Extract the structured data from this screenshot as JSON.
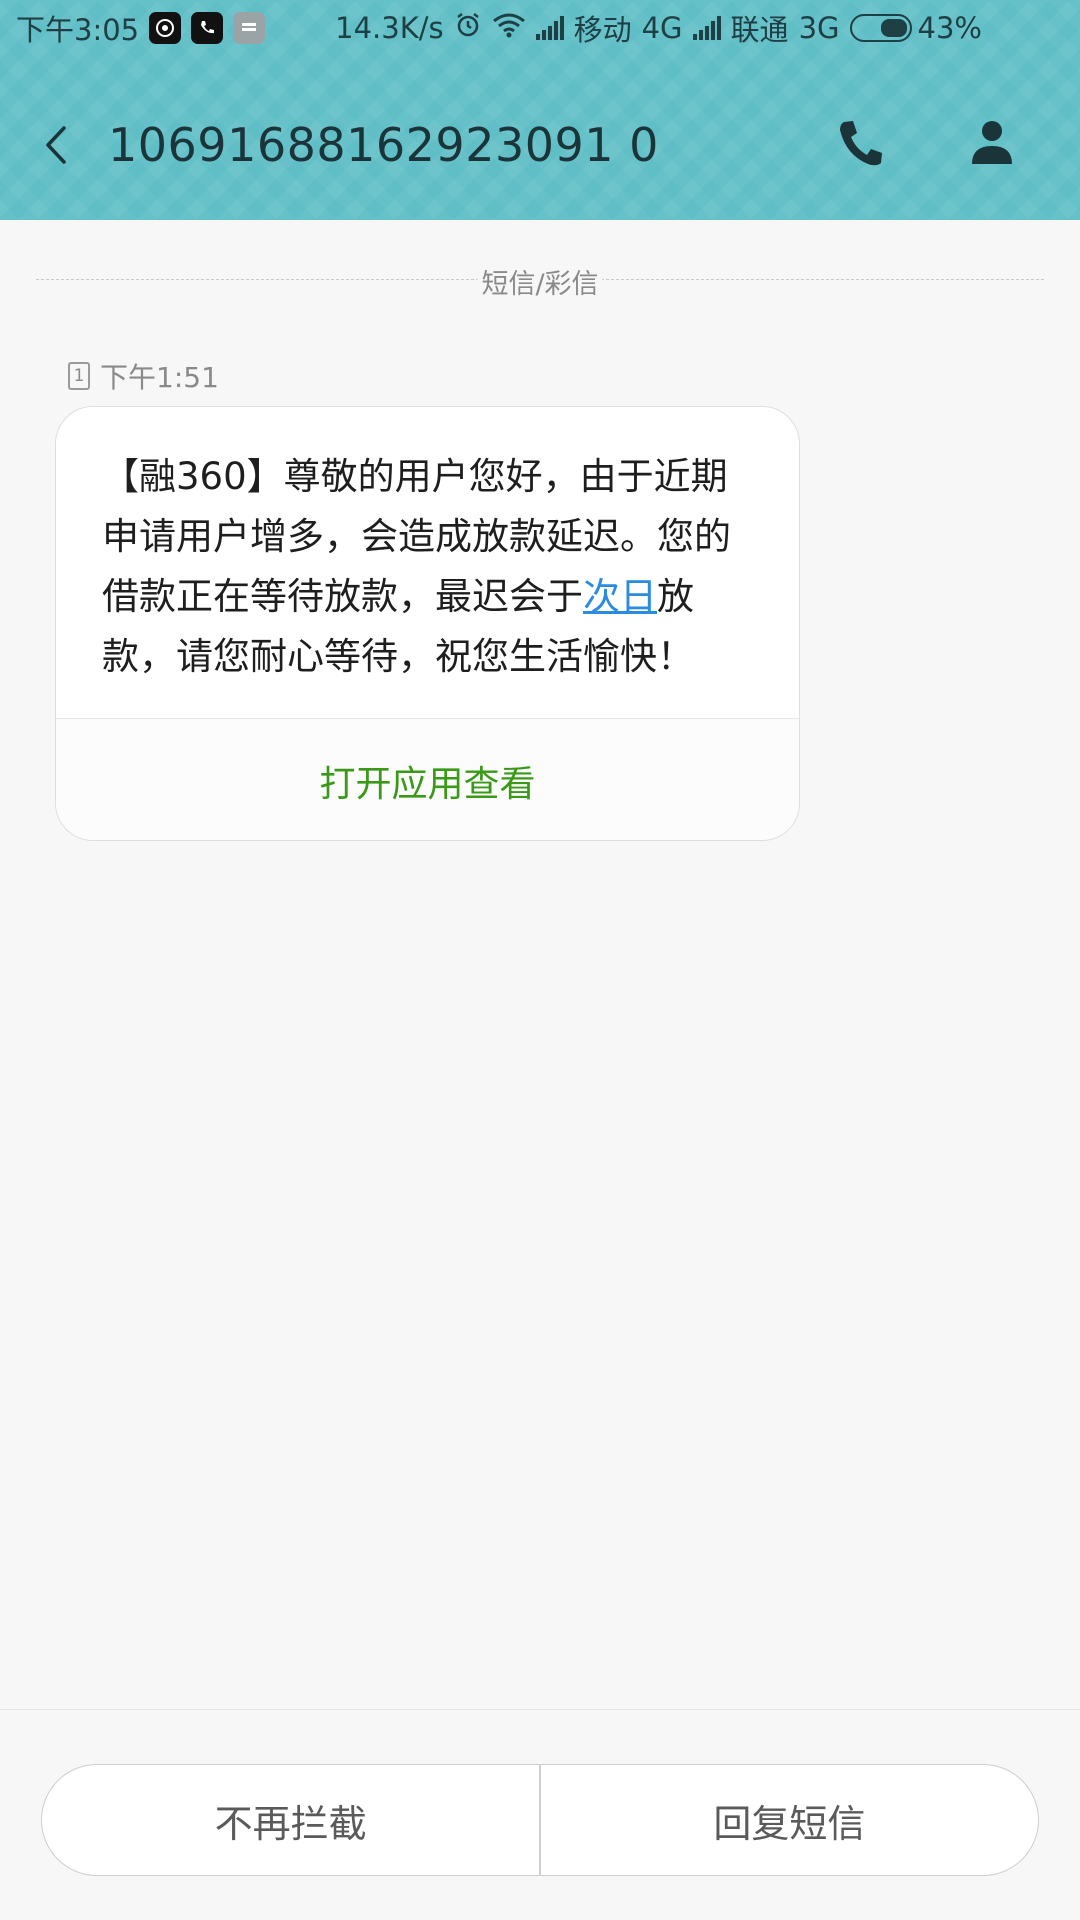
{
  "status_bar": {
    "time": "下午3:05",
    "net_speed": "14.3K/s",
    "carrier1": "移动",
    "net1": "4G",
    "carrier2": "联通",
    "net2": "3G",
    "battery": "43%",
    "icons": [
      "app-icon",
      "app-icon",
      "app-icon",
      "alarm-icon",
      "wifi-icon",
      "signal-icon",
      "battery-icon"
    ]
  },
  "header": {
    "title": "10691688162923091 0",
    "back_icon": "chevron-left-icon",
    "call_icon": "phone-icon",
    "contact_icon": "person-icon"
  },
  "conversation": {
    "divider_label": "短信/彩信",
    "message": {
      "sim": "1",
      "time": "下午1:51",
      "text_before_link": "【融360】尊敬的用户您好，由于近期申请用户增多，会造成放款延迟。您的借款正在等待放款，最迟会于",
      "link_text": "次日",
      "text_after_link": "放款，请您耐心等待，祝您生活愉快！",
      "action_label": "打开应用查看"
    }
  },
  "bottom_actions": {
    "left_label": "不再拦截",
    "right_label": "回复短信"
  },
  "colors": {
    "header_bg": "#5fbec6",
    "link": "#2a8be0",
    "action_green": "#3a9a17"
  }
}
